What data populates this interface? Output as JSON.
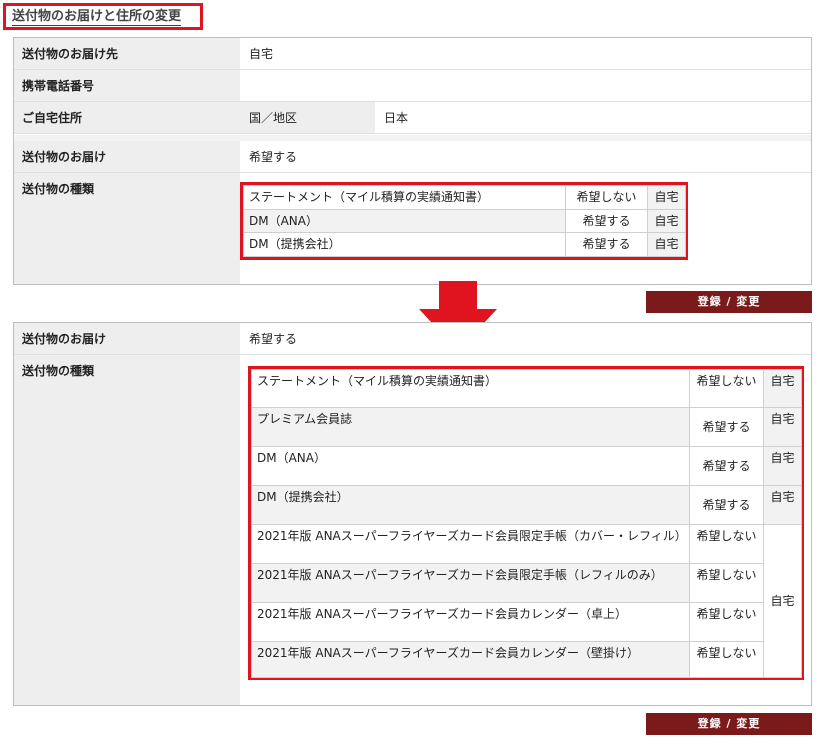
{
  "page_title": "送付物のお届けと住所の変更",
  "before": {
    "delivery_to": {
      "label": "送付物のお届け先",
      "value": "自宅"
    },
    "mobile": {
      "label": "携帯電話番号",
      "value": ""
    },
    "home_address": {
      "label": "ご自宅住所",
      "sub_label": "国／地区",
      "value": "日本"
    },
    "delivery": {
      "label": "送付物のお届け",
      "value": "希望する"
    },
    "types": {
      "label": "送付物の種類",
      "rows": [
        {
          "name": "ステートメント（マイル積算の実績通知書）",
          "answer": "希望しない",
          "dest": "自宅"
        },
        {
          "name": "DM（ANA）",
          "answer": "希望する",
          "dest": "自宅"
        },
        {
          "name": "DM（提携会社）",
          "answer": "希望する",
          "dest": "自宅"
        }
      ]
    },
    "button": "登録 / 変更"
  },
  "after": {
    "delivery": {
      "label": "送付物のお届け",
      "value": "希望する"
    },
    "types": {
      "label": "送付物の種類",
      "rows": [
        {
          "name": "ステートメント（マイル積算の実績通知書）",
          "answer": "希望しない",
          "dest": "自宅"
        },
        {
          "name": "プレミアム会員誌",
          "answer": "希望する",
          "dest": "自宅"
        },
        {
          "name": "DM（ANA）",
          "answer": "希望する",
          "dest": "自宅"
        },
        {
          "name": "DM（提携会社）",
          "answer": "希望する",
          "dest": "自宅"
        },
        {
          "name": "2021年版 ANAスーパーフライヤーズカード会員限定手帳（カバー・レフィル）",
          "answer": "希望しない"
        },
        {
          "name": "2021年版 ANAスーパーフライヤーズカード会員限定手帳（レフィルのみ）",
          "answer": "希望しない"
        },
        {
          "name": "2021年版 ANAスーパーフライヤーズカード会員カレンダー（卓上）",
          "answer": "希望しない"
        },
        {
          "name": "2021年版 ANAスーパーフライヤーズカード会員カレンダー（壁掛け）",
          "answer": "希望しない"
        }
      ],
      "merged_dest": "自宅"
    },
    "button": "登録 / 変更"
  },
  "colors": {
    "highlight": "#e0141f",
    "button": "#7a1a1a",
    "arrow": "#e0141f"
  },
  "icons": {
    "arrow": "down-arrow-icon"
  }
}
